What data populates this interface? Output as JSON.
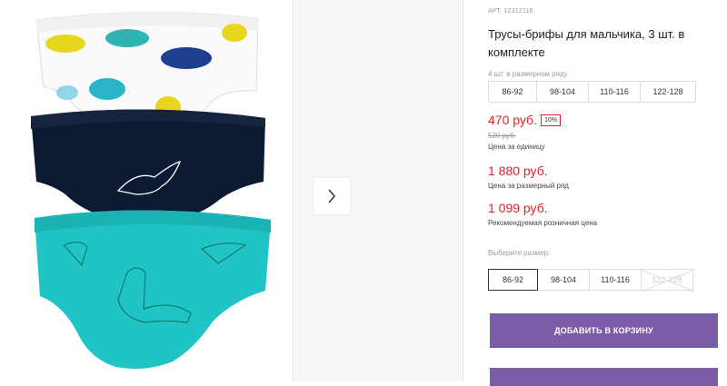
{
  "product": {
    "art": "АРТ. 12312116",
    "title": "Трусы-брифы для мальчика, 3 шт. в комплекте",
    "row_label": "4 шт. в размерном ряду",
    "row_sizes": [
      "86-92",
      "98-104",
      "110-116",
      "122-128"
    ],
    "price": "470 руб.",
    "discount": "10%",
    "old_price": "520 руб.",
    "unit_note": "Цена за единицу",
    "row_price": "1 880 руб.",
    "row_note": "Цена за размерный ряд",
    "rrp": "1 099 руб.",
    "rrp_note": "Рекомендуемая розничная цена",
    "choose_label": "Выберите размер:",
    "choose_sizes": [
      "86-92",
      "98-104",
      "110-116",
      "122-128"
    ],
    "selected_size": "86-92",
    "disabled_size": "122-128",
    "add_to_cart": "ДОБАВИТЬ В КОРЗИНУ"
  },
  "gallery": {
    "next_icon": "chevron-right-icon"
  },
  "colors": {
    "accent": "#7b5ea7",
    "price_red": "#e0202c",
    "teal": "#20c4c4",
    "navy": "#0d1a33"
  }
}
